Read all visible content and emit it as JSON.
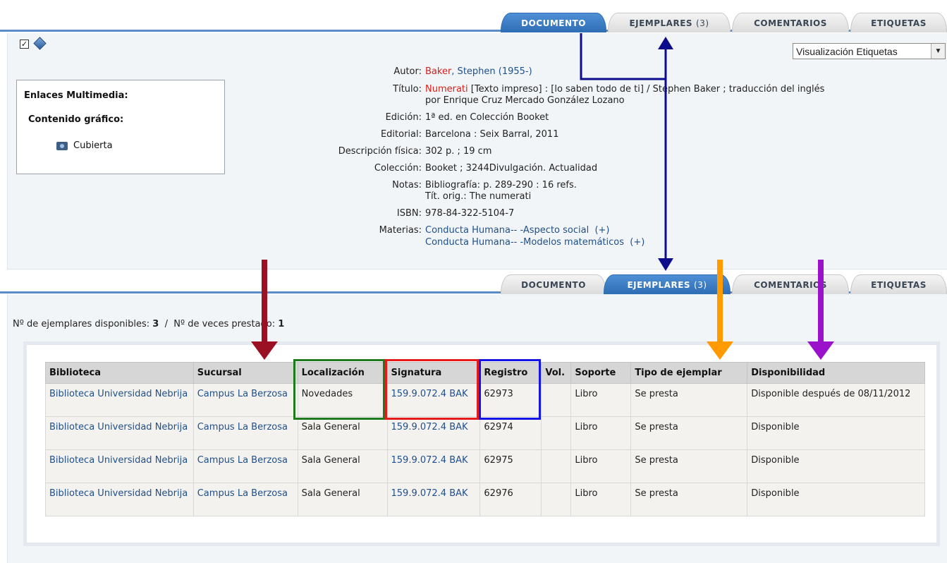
{
  "tabs_top": [
    {
      "label": "DOCUMENTO",
      "active": true
    },
    {
      "label": "EJEMPLARES",
      "count": "(3)",
      "active": false
    },
    {
      "label": "COMENTARIOS",
      "active": false
    },
    {
      "label": "ETIQUETAS",
      "active": false
    }
  ],
  "tabs_bottom": [
    {
      "label": "DOCUMENTO",
      "active": false
    },
    {
      "label": "EJEMPLARES",
      "count": "(3)",
      "active": true
    },
    {
      "label": "COMENTARIOS",
      "active": false
    },
    {
      "label": "ETIQUETAS",
      "active": false
    }
  ],
  "view_select": {
    "value": "Visualización Etiquetas"
  },
  "multimedia": {
    "title": "Enlaces Multimedia:",
    "subtitle": "Contenido gráfico:",
    "cover_label": "Cubierta"
  },
  "record": {
    "autor_label": "Autor:",
    "autor_surname": "Baker",
    "autor_rest": ", Stephen (1955-)",
    "titulo_label": "Título:",
    "titulo_main": "Numerati",
    "titulo_rest": " [Texto impreso] : [lo saben todo de ti] / Stephen Baker ; traducción del inglés",
    "titulo_line2": "por Enrique Cruz Mercado González Lozano",
    "edicion_label": "Edición:",
    "edicion": "1ª ed. en Colección Booket",
    "editorial_label": "Editorial:",
    "editorial": "Barcelona : Seix Barral, 2011",
    "descripcion_label": "Descripción física:",
    "descripcion": "302 p. ; 19 cm",
    "coleccion_label": "Colección:",
    "coleccion": "Booket ; 3244Divulgación. Actualidad",
    "notas_label": "Notas:",
    "notas_1": "Bibliografía: p. 289-290 : 16 refs.",
    "notas_2": "Tít. orig.: The numerati",
    "isbn_label": "ISBN:",
    "isbn": "978-84-322-5104-7",
    "materias_label": "Materias:",
    "materia_1": "Conducta Humana-- -Aspecto social",
    "materia_2": "Conducta Humana-- -Modelos matemáticos",
    "plus": "(+)"
  },
  "counts": {
    "disponibles_label": "Nº de ejemplares disponibles:",
    "disponibles": "3",
    "separator": "/",
    "prestado_label": "Nº de veces prestado:",
    "prestado": "1"
  },
  "table": {
    "headers": [
      "Biblioteca",
      "Sucursal",
      "Localización",
      "Signatura",
      "Registro",
      "Vol.",
      "Soporte",
      "Tipo de ejemplar",
      "Disponibilidad"
    ],
    "rows": [
      {
        "biblioteca": "Biblioteca Universidad Nebrija",
        "sucursal": "Campus La Berzosa",
        "localizacion": "Novedades",
        "signatura": "159.9.072.4 BAK",
        "registro": "62973",
        "vol": "",
        "soporte": "Libro",
        "tipo": "Se presta",
        "disponibilidad": "Disponible después de 08/11/2012"
      },
      {
        "biblioteca": "Biblioteca Universidad Nebrija",
        "sucursal": "Campus La Berzosa",
        "localizacion": "Sala General",
        "signatura": "159.9.072.4 BAK",
        "registro": "62974",
        "vol": "",
        "soporte": "Libro",
        "tipo": "Se presta",
        "disponibilidad": "Disponible"
      },
      {
        "biblioteca": "Biblioteca Universidad Nebrija",
        "sucursal": "Campus La Berzosa",
        "localizacion": "Sala General",
        "signatura": "159.9.072.4 BAK",
        "registro": "62975",
        "vol": "",
        "soporte": "Libro",
        "tipo": "Se presta",
        "disponibilidad": "Disponible"
      },
      {
        "biblioteca": "Biblioteca Universidad Nebrija",
        "sucursal": "Campus La Berzosa",
        "localizacion": "Sala General",
        "signatura": "159.9.072.4 BAK",
        "registro": "62976",
        "vol": "",
        "soporte": "Libro",
        "tipo": "Se presta",
        "disponibilidad": "Disponible"
      }
    ]
  },
  "annotation_colors": {
    "navy": "#0d0d8c",
    "darkred": "#9b1022",
    "green": "#1f7a1f",
    "red": "#e51a1a",
    "blue": "#1414e6",
    "orange": "#ff9a00",
    "purple": "#9a12c9"
  }
}
